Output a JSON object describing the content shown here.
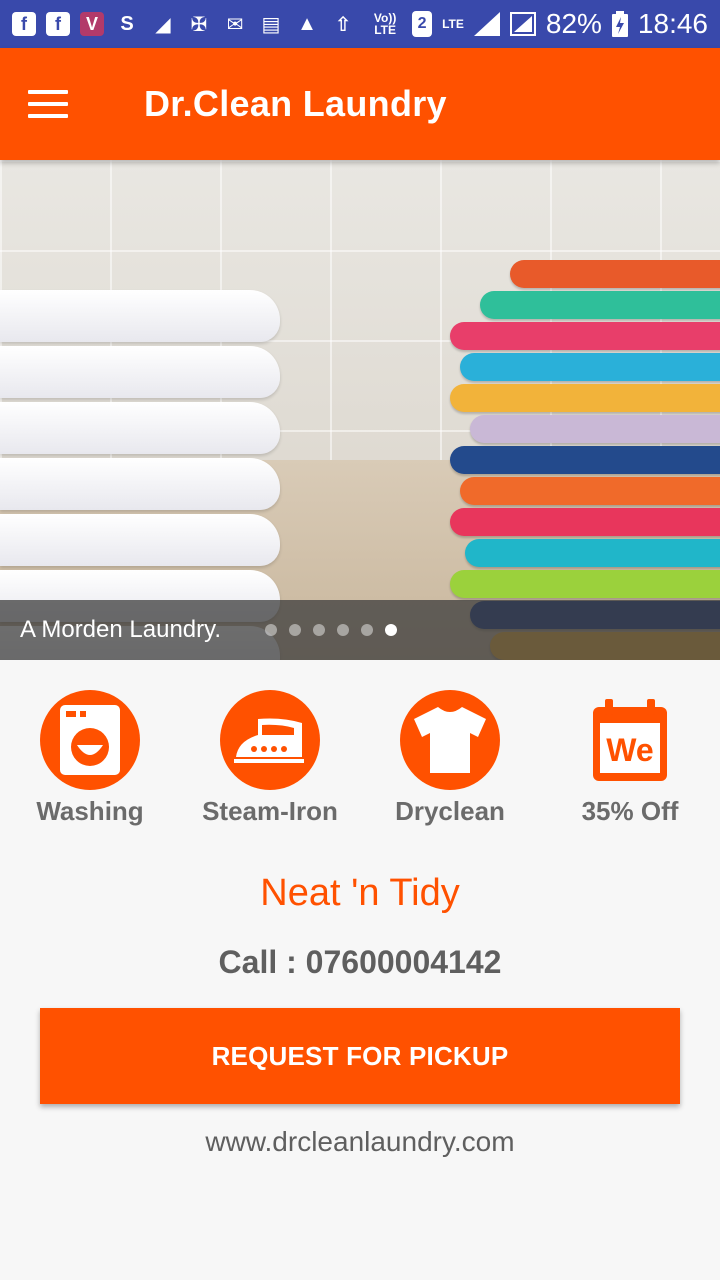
{
  "status_bar": {
    "icons": [
      "facebook-icon",
      "facebook-icon",
      "viber-icon",
      "skype-icon",
      "flipboard-icon",
      "pinwheel-icon",
      "mail-icon",
      "news-icon",
      "warning-icon",
      "upload-icon"
    ],
    "volte": "Vo)) LTE",
    "sim": "2",
    "network": "LTE",
    "battery": "82%",
    "time": "18:46"
  },
  "app_bar": {
    "title": "Dr.Clean Laundry"
  },
  "banner": {
    "caption": "A Morden Laundry.",
    "slide_count": 6,
    "active_slide": 6
  },
  "services": [
    {
      "label": "Washing",
      "icon": "washing-machine-icon"
    },
    {
      "label": "Steam-Iron",
      "icon": "iron-icon"
    },
    {
      "label": "Dryclean",
      "icon": "tshirt-icon"
    },
    {
      "label": "35% Off",
      "icon": "calendar-icon",
      "icon_text": "We"
    }
  ],
  "tagline": "Neat 'n Tidy",
  "call": "Call : 07600004142",
  "pickup_button": "REQUEST FOR PICKUP",
  "website": "www.drcleanlaundry.com",
  "colors": {
    "status_bar": "#3949ab",
    "accent": "#ff5100",
    "text_gray": "#5f5f5f",
    "background": "#f7f7f7"
  }
}
